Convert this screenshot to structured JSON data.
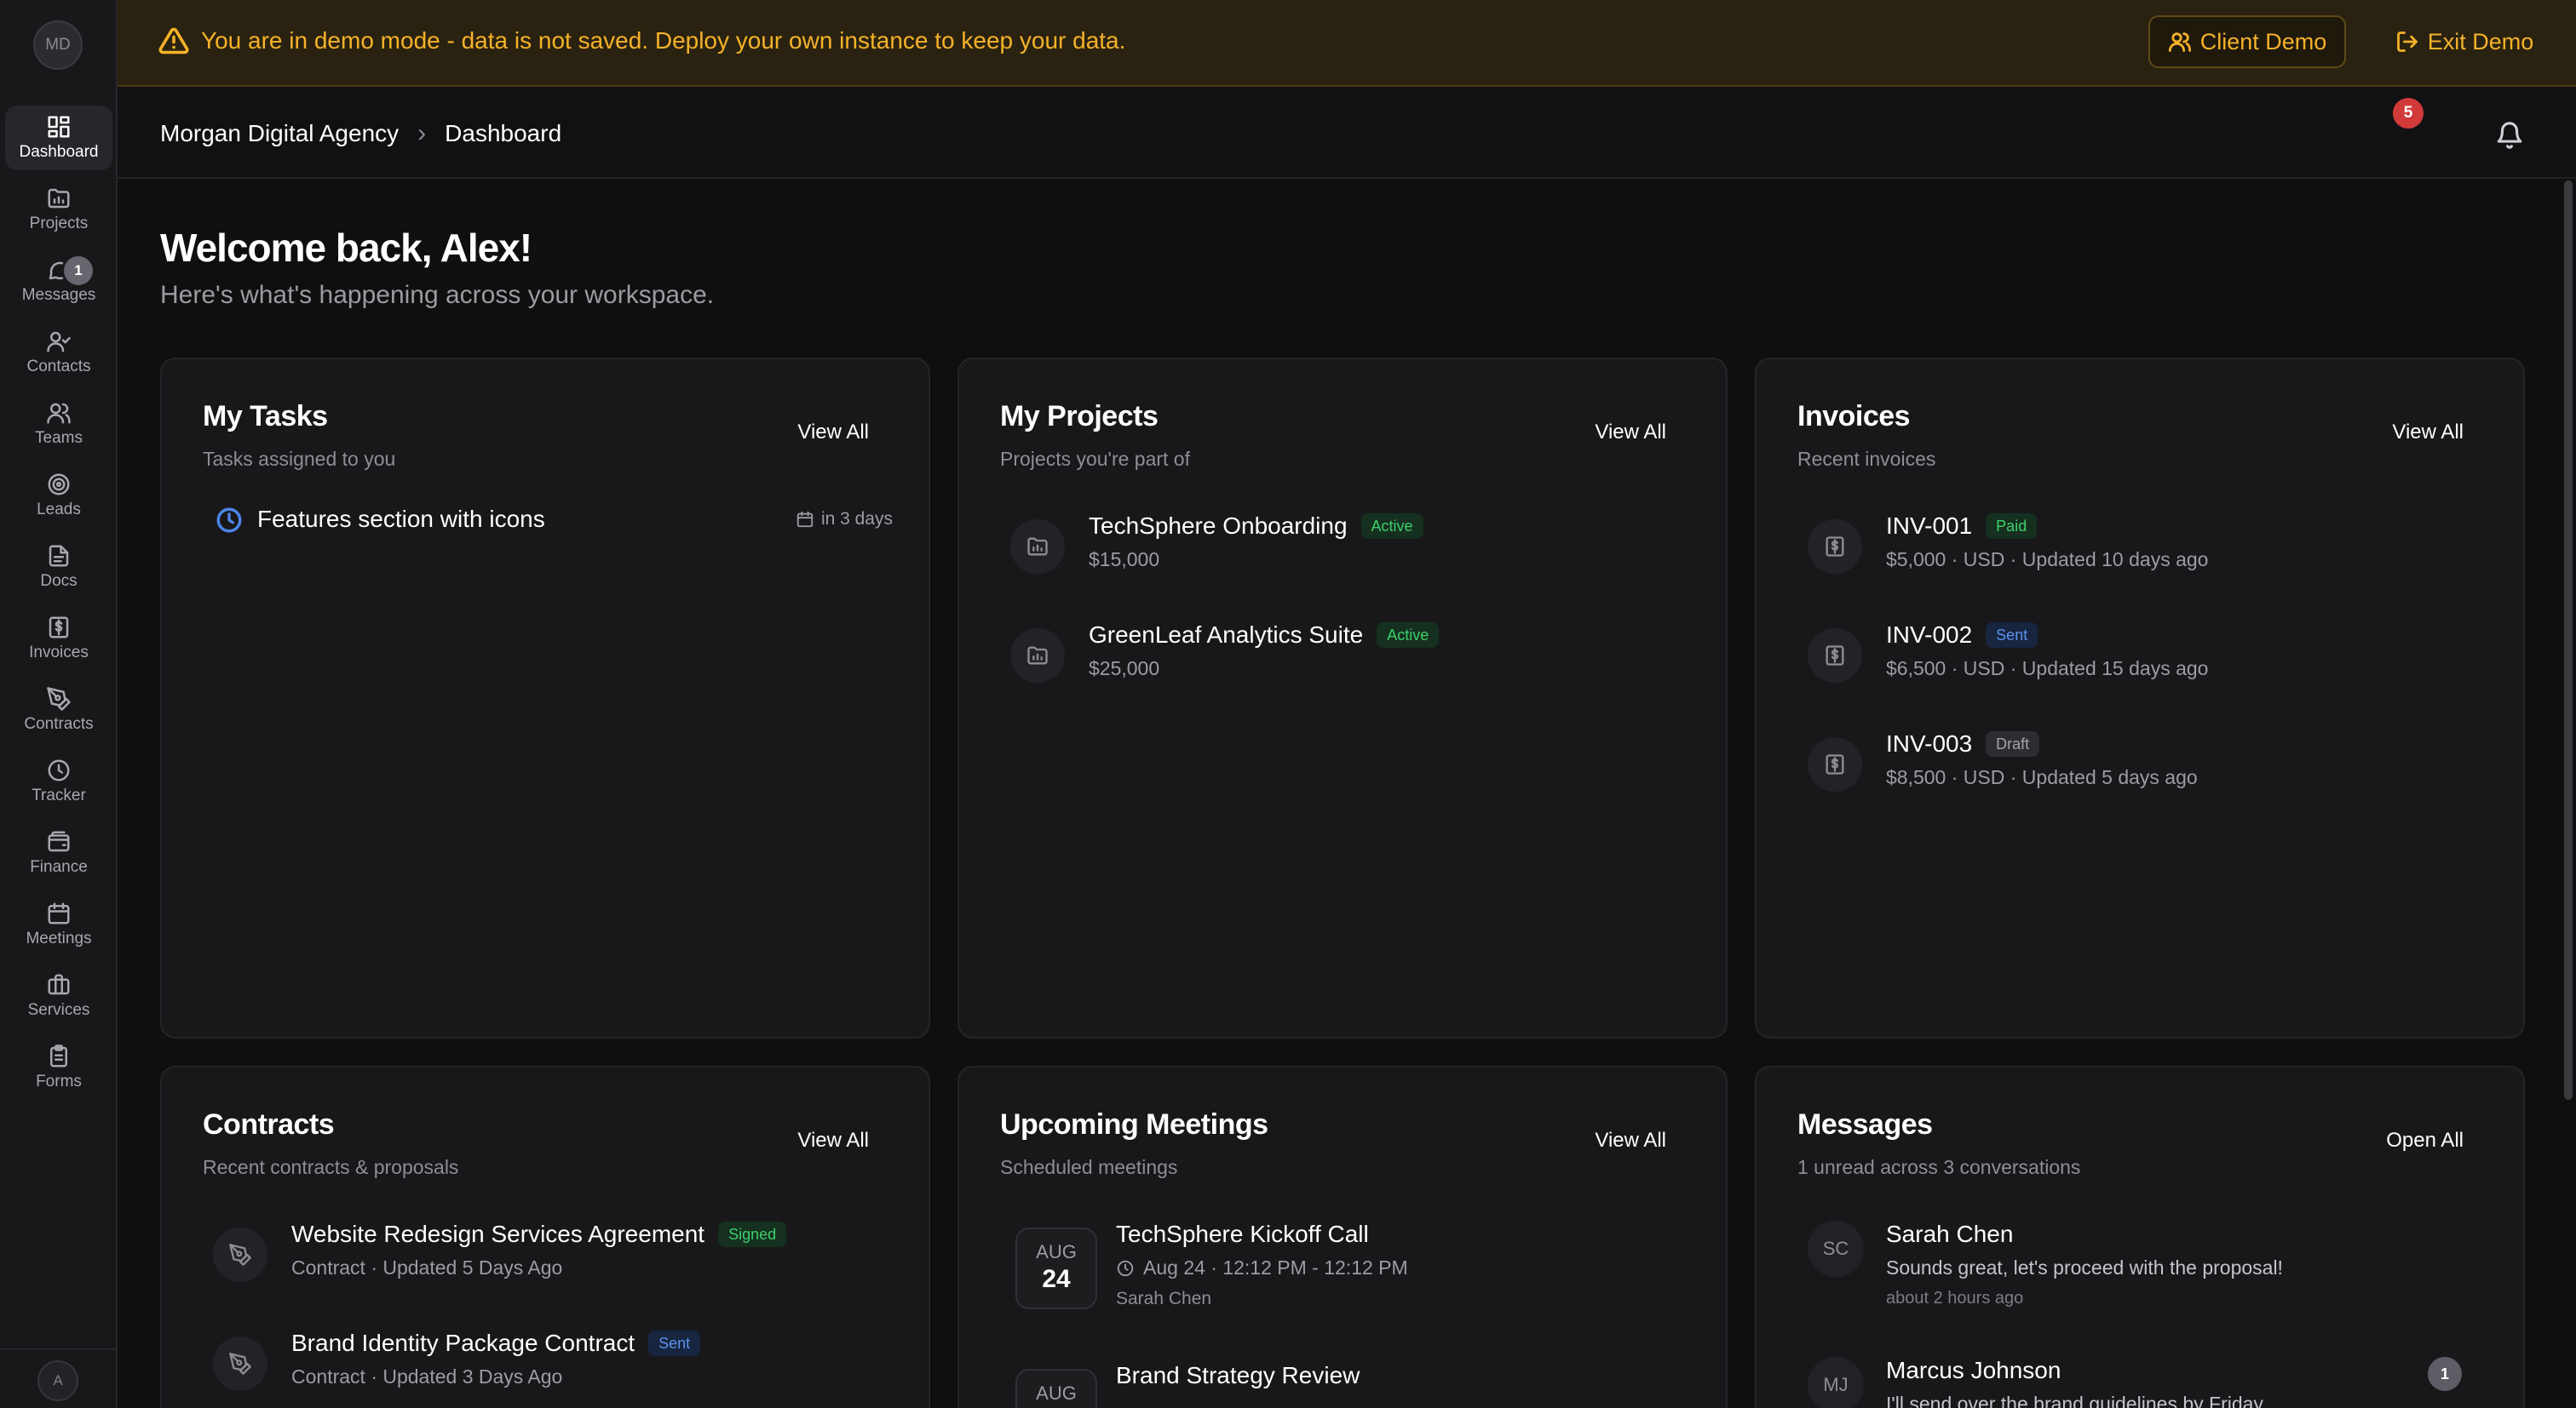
{
  "colors": {
    "accent": "#f5b229",
    "banner_bg": "#2a2210",
    "badge_red": "#d23a3a",
    "active_green": "#3fcf6b",
    "sent_blue": "#5b92ef"
  },
  "sidebar": {
    "avatar_initials": "MD",
    "items": [
      {
        "label": "Dashboard",
        "icon": "dashboard-icon"
      },
      {
        "label": "Projects",
        "icon": "folder-chart-icon"
      },
      {
        "label": "Messages",
        "icon": "message-icon",
        "badge": "1"
      },
      {
        "label": "Contacts",
        "icon": "user-check-icon"
      },
      {
        "label": "Teams",
        "icon": "users-icon"
      },
      {
        "label": "Leads",
        "icon": "target-icon"
      },
      {
        "label": "Docs",
        "icon": "document-icon"
      },
      {
        "label": "Invoices",
        "icon": "invoice-dollar-icon"
      },
      {
        "label": "Contracts",
        "icon": "pen-nib-icon"
      },
      {
        "label": "Tracker",
        "icon": "clock-icon"
      },
      {
        "label": "Finance",
        "icon": "wallet-icon"
      },
      {
        "label": "Meetings",
        "icon": "calendar-icon"
      },
      {
        "label": "Services",
        "icon": "briefcase-icon"
      },
      {
        "label": "Forms",
        "icon": "clipboard-icon"
      }
    ],
    "footer_initials": "A"
  },
  "banner": {
    "text": "You are in demo mode - data is not saved. Deploy your own instance to keep your data.",
    "client_demo_label": "Client Demo",
    "exit_demo_label": "Exit Demo"
  },
  "header": {
    "breadcrumb": [
      "Morgan Digital Agency",
      "Dashboard"
    ],
    "notification_count": "5"
  },
  "welcome": {
    "title": "Welcome back, Alex!",
    "subtitle": "Here's what's happening across your workspace."
  },
  "tasks": {
    "title": "My Tasks",
    "subtitle": "Tasks assigned to you",
    "link": "View All",
    "items": [
      {
        "title": "Features section with icons",
        "due": "in 3 days"
      }
    ]
  },
  "projects": {
    "title": "My Projects",
    "subtitle": "Projects you're part of",
    "link": "View All",
    "items": [
      {
        "name": "TechSphere Onboarding",
        "status": "Active",
        "amount": "$15,000"
      },
      {
        "name": "GreenLeaf Analytics Suite",
        "status": "Active",
        "amount": "$25,000"
      }
    ]
  },
  "invoices": {
    "title": "Invoices",
    "subtitle": "Recent invoices",
    "link": "View All",
    "items": [
      {
        "id": "INV-001",
        "status": "Paid",
        "meta": "$5,000 · USD · Updated 10 days ago"
      },
      {
        "id": "INV-002",
        "status": "Sent",
        "meta": "$6,500 · USD · Updated 15 days ago"
      },
      {
        "id": "INV-003",
        "status": "Draft",
        "meta": "$8,500 · USD · Updated 5 days ago"
      }
    ]
  },
  "contracts": {
    "title": "Contracts",
    "subtitle": "Recent contracts & proposals",
    "link": "View All",
    "items": [
      {
        "name": "Website Redesign Services Agreement",
        "status": "Signed",
        "meta": "Contract · Updated 5 Days Ago"
      },
      {
        "name": "Brand Identity Package Contract",
        "status": "Sent",
        "meta": "Contract · Updated 3 Days Ago"
      }
    ]
  },
  "meetings": {
    "title": "Upcoming Meetings",
    "subtitle": "Scheduled meetings",
    "link": "View All",
    "items": [
      {
        "month": "AUG",
        "day": "24",
        "title": "TechSphere Kickoff Call",
        "time": "Aug 24 · 12:12 PM - 12:12 PM",
        "who": "Sarah Chen"
      },
      {
        "month": "AUG",
        "day": "",
        "title": "Brand Strategy Review",
        "time": "",
        "who": ""
      }
    ]
  },
  "messages": {
    "title": "Messages",
    "subtitle": "1 unread across 3 conversations",
    "link": "Open All",
    "items": [
      {
        "initials": "SC",
        "name": "Sarah Chen",
        "text": "Sounds great, let's proceed with the proposal!",
        "time": "about 2 hours ago",
        "unread": ""
      },
      {
        "initials": "MJ",
        "name": "Marcus Johnson",
        "text": "I'll send over the brand guidelines by Friday.",
        "time": "",
        "unread": "1"
      }
    ]
  }
}
